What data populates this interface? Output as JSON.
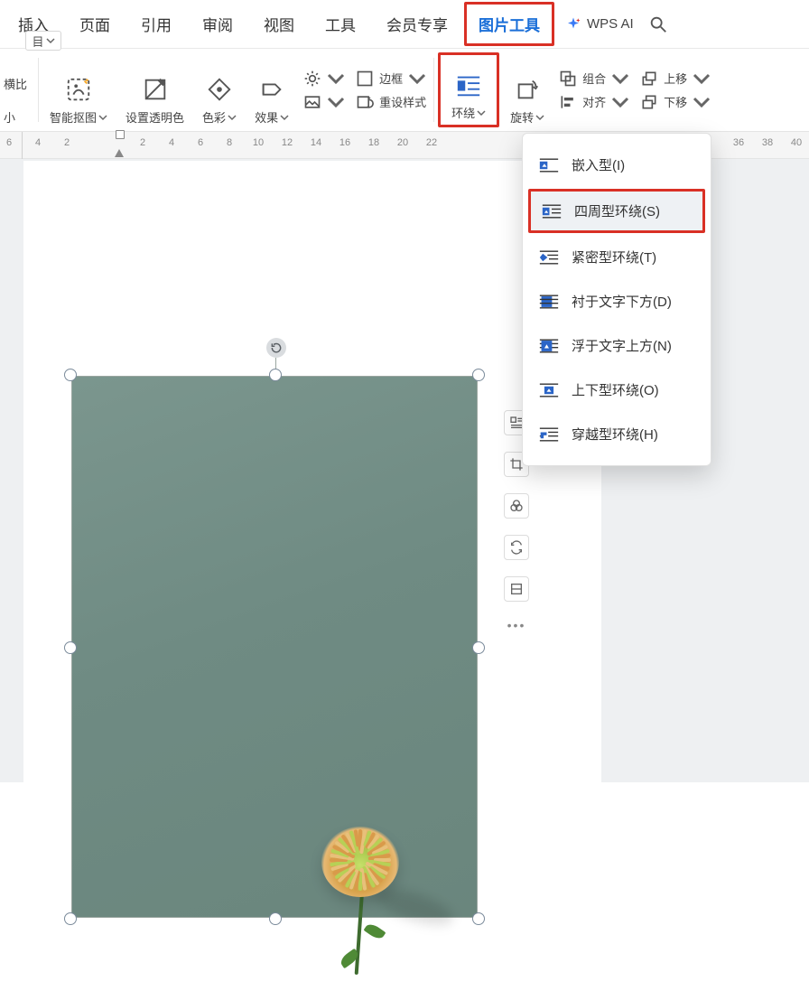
{
  "tabs": {
    "insert": "插入",
    "page": "页面",
    "reference": "引用",
    "review": "审阅",
    "view": "视图",
    "tools": "工具",
    "member": "会员专享",
    "picture_tools": "图片工具",
    "wps_ai": "WPS AI"
  },
  "ribbon": {
    "trunc_top": "横比",
    "trunc_bottom": "小",
    "smart_cutout": "智能抠图",
    "set_transparent": "设置透明色",
    "color": "色彩",
    "effect": "效果",
    "brightness_icon": "brightness",
    "reset_icon": "reset-picture",
    "border": "边框",
    "reset_style": "重设样式",
    "wrap": "环绕",
    "rotate": "旋转",
    "group": "组合",
    "align": "对齐",
    "move_up": "上移",
    "move_down": "下移"
  },
  "ruler": {
    "ticks": [
      "6",
      "4",
      "2",
      "",
      "2",
      "4",
      "6",
      "8",
      "10",
      "12",
      "14",
      "16",
      "18",
      "20",
      "22",
      "36",
      "38",
      "40"
    ],
    "header_btn": "目"
  },
  "wrap_menu": {
    "inline": "嵌入型(I)",
    "square": "四周型环绕(S)",
    "tight": "紧密型环绕(T)",
    "behind": "衬于文字下方(D)",
    "front": "浮于文字上方(N)",
    "topbottom": "上下型环绕(O)",
    "through": "穿越型环绕(H)"
  }
}
